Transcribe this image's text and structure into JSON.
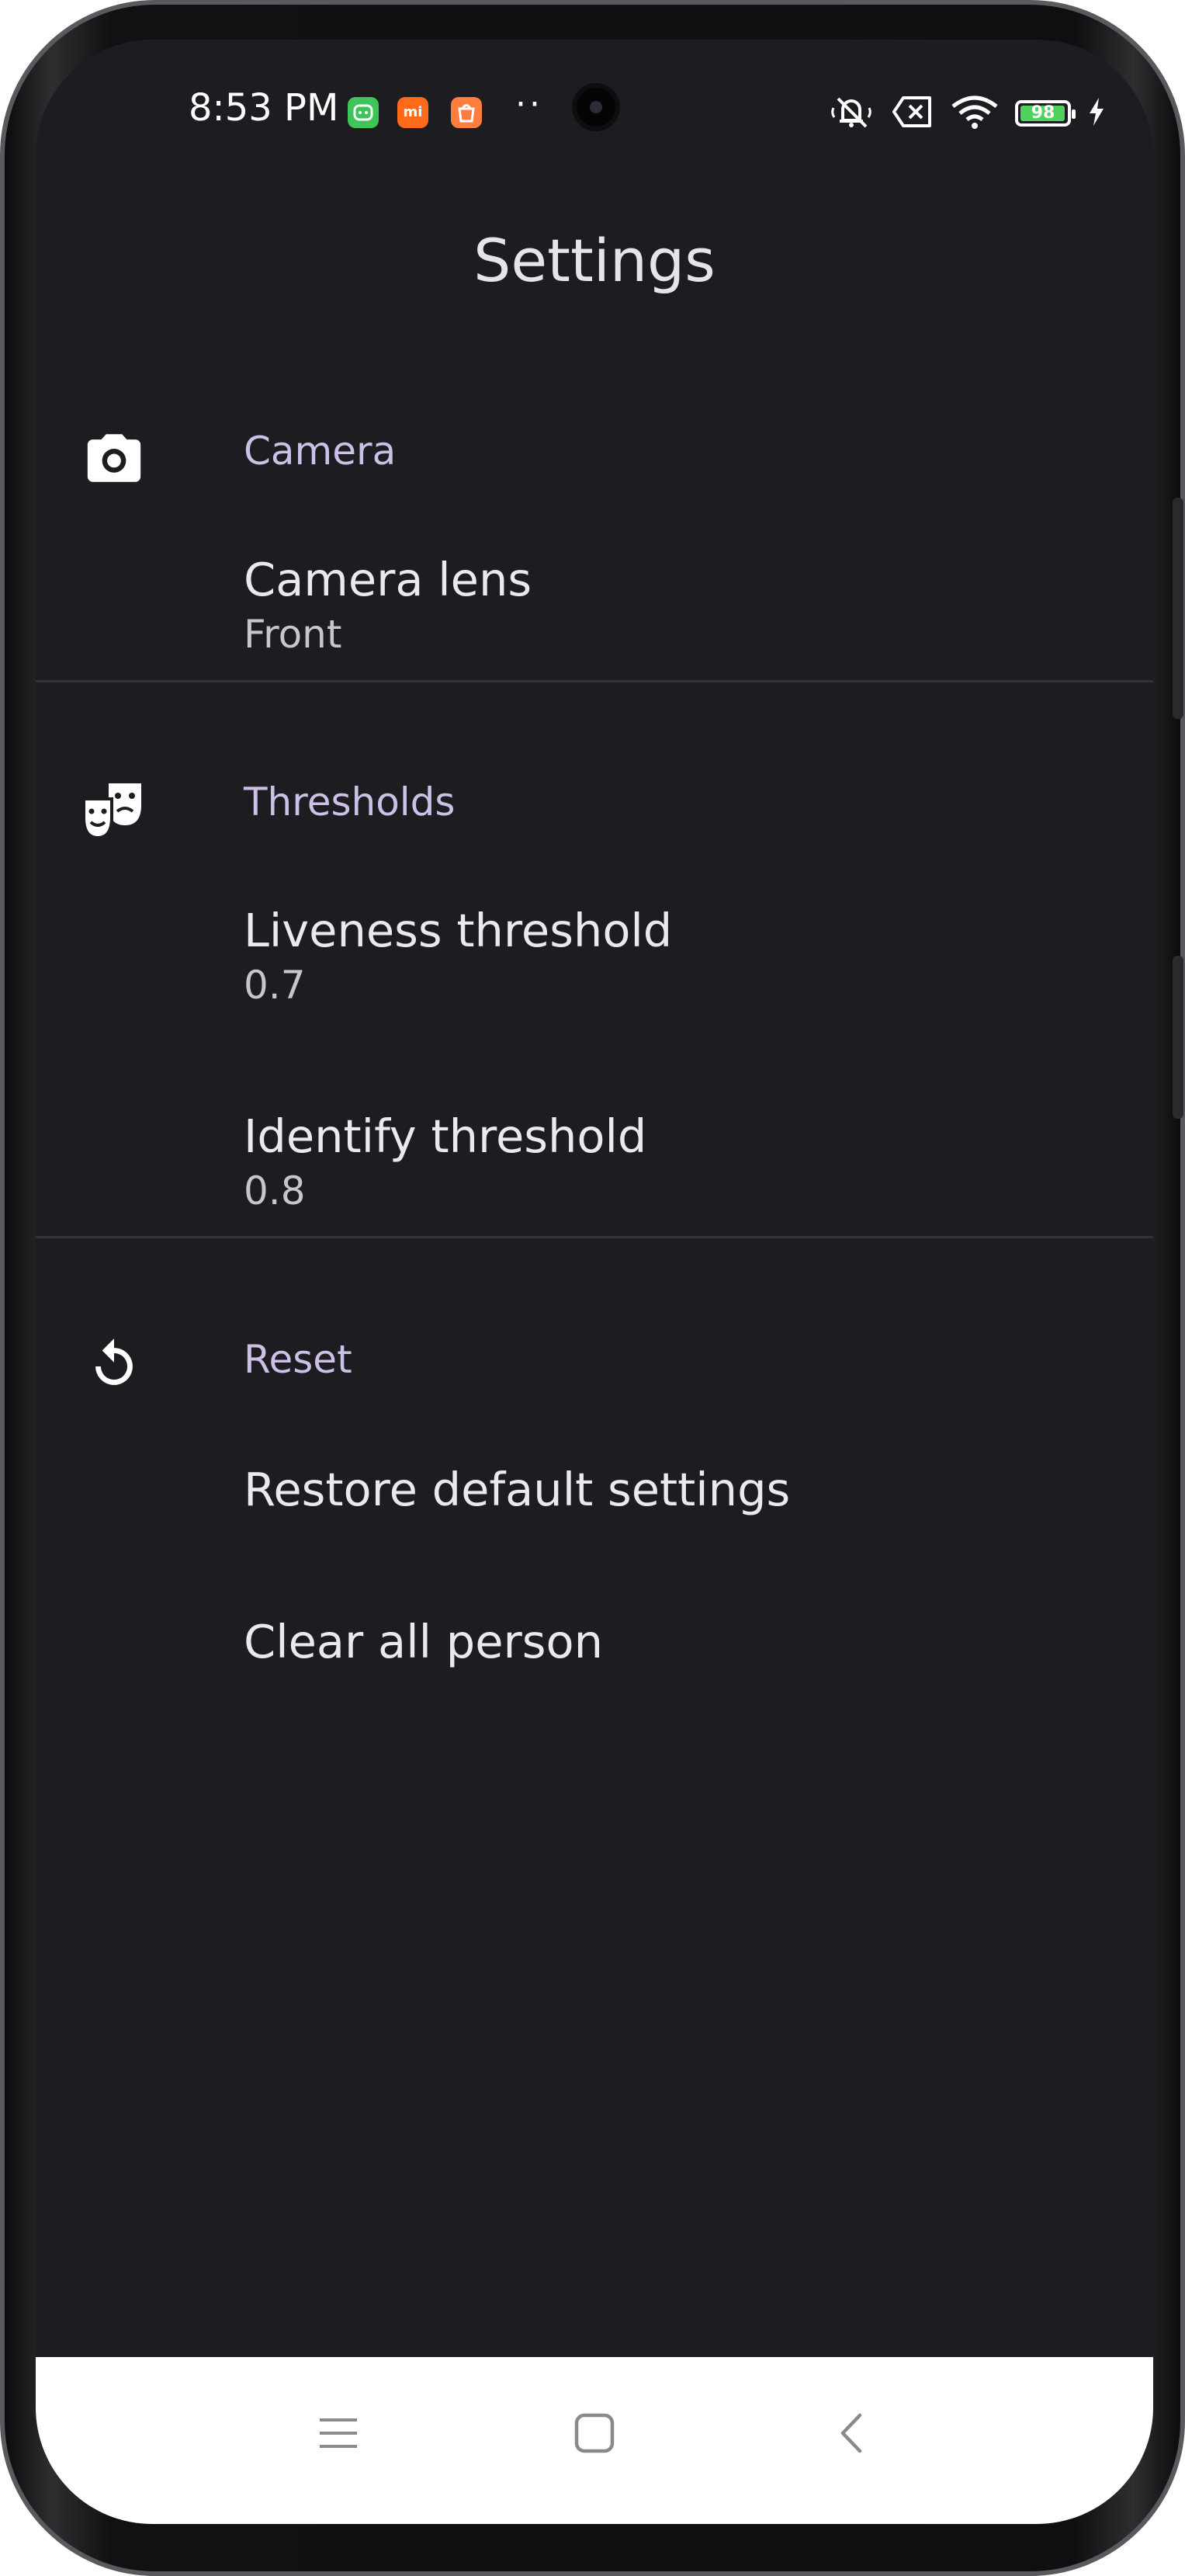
{
  "status_bar": {
    "time": "8:53 PM",
    "more_indicator": "··",
    "battery_level": "98",
    "battery_fraction": 0.98,
    "icons": [
      "notification-app-icon",
      "mi-app-icon",
      "mi-store-icon",
      "mute-icon",
      "no-sim-icon",
      "wifi-icon",
      "battery-icon",
      "charging-icon"
    ],
    "app_icon_labels": {
      "mi": "mi"
    }
  },
  "header": {
    "title": "Settings"
  },
  "sections": [
    {
      "header": "Camera",
      "icon": "camera-icon",
      "items": [
        {
          "title": "Camera lens",
          "summary": "Front"
        }
      ]
    },
    {
      "header": "Thresholds",
      "icon": "theater-masks-icon",
      "items": [
        {
          "title": "Liveness threshold",
          "summary": "0.7"
        },
        {
          "title": "Identify threshold",
          "summary": "0.8"
        }
      ]
    },
    {
      "header": "Reset",
      "icon": "restore-icon",
      "items": [
        {
          "title": "Restore default settings"
        },
        {
          "title": "Clear all person"
        }
      ]
    }
  ],
  "nav_bar": {
    "icons": [
      "menu-icon",
      "home-icon",
      "back-icon"
    ]
  },
  "colors": {
    "background": "#1d1c21",
    "section_header": "#cdc0e6",
    "title_text": "#ebe8ee",
    "summary_text": "#c8c5cc",
    "divider": "#333238",
    "nav_bar": "#ffffff"
  }
}
